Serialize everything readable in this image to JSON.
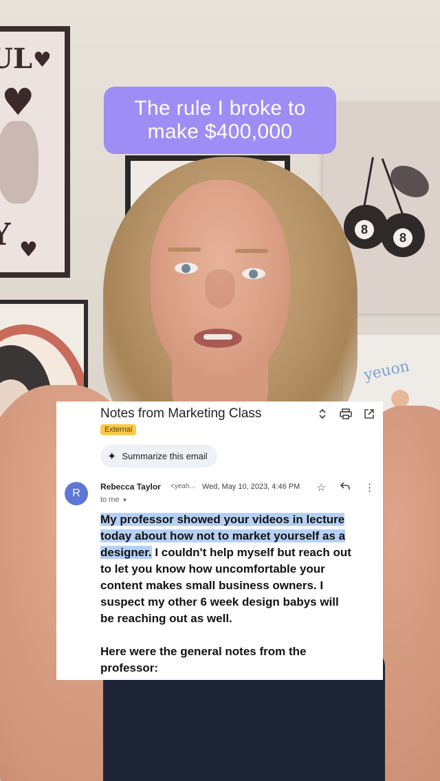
{
  "caption": {
    "line1": "The rule I broke to",
    "line2": "make $400,000"
  },
  "email": {
    "subject": "Notes from Marketing Class",
    "badge": "External",
    "summarize_label": "Summarize this email",
    "avatar_letter": "R",
    "sender_name": "Rebecca Taylor",
    "sender_email": "<yeah...",
    "date": "Wed, May 10, 2023, 4:46 PM",
    "to": "to me",
    "body_highlight_1": "My professor showed your videos in lecture",
    "body_highlight_2": "today about how not to market yourself as a",
    "body_highlight_3": "designer.",
    "body_rest_1": " I couldn't help myself but reach out",
    "body_rest_2": "to let you know how uncomfortable your",
    "body_rest_3": "content makes small business owners. I",
    "body_rest_4": "suspect my other 6 week design babys will",
    "body_rest_5": "be reaching out as well.",
    "notes_1": "Here were the general notes from the",
    "notes_2": "professor:"
  },
  "icons": {
    "expand": "unfold-icon",
    "print": "print-icon",
    "open": "open-in-new-icon",
    "star": "star-icon",
    "reply": "reply-icon",
    "more": "more-vert-icon",
    "spark": "sparkle-icon"
  },
  "colors": {
    "caption_bg": "#9e8df5",
    "highlight": "#b5d0f4",
    "badge": "#fbc94a",
    "avatar": "#5e77d3"
  }
}
